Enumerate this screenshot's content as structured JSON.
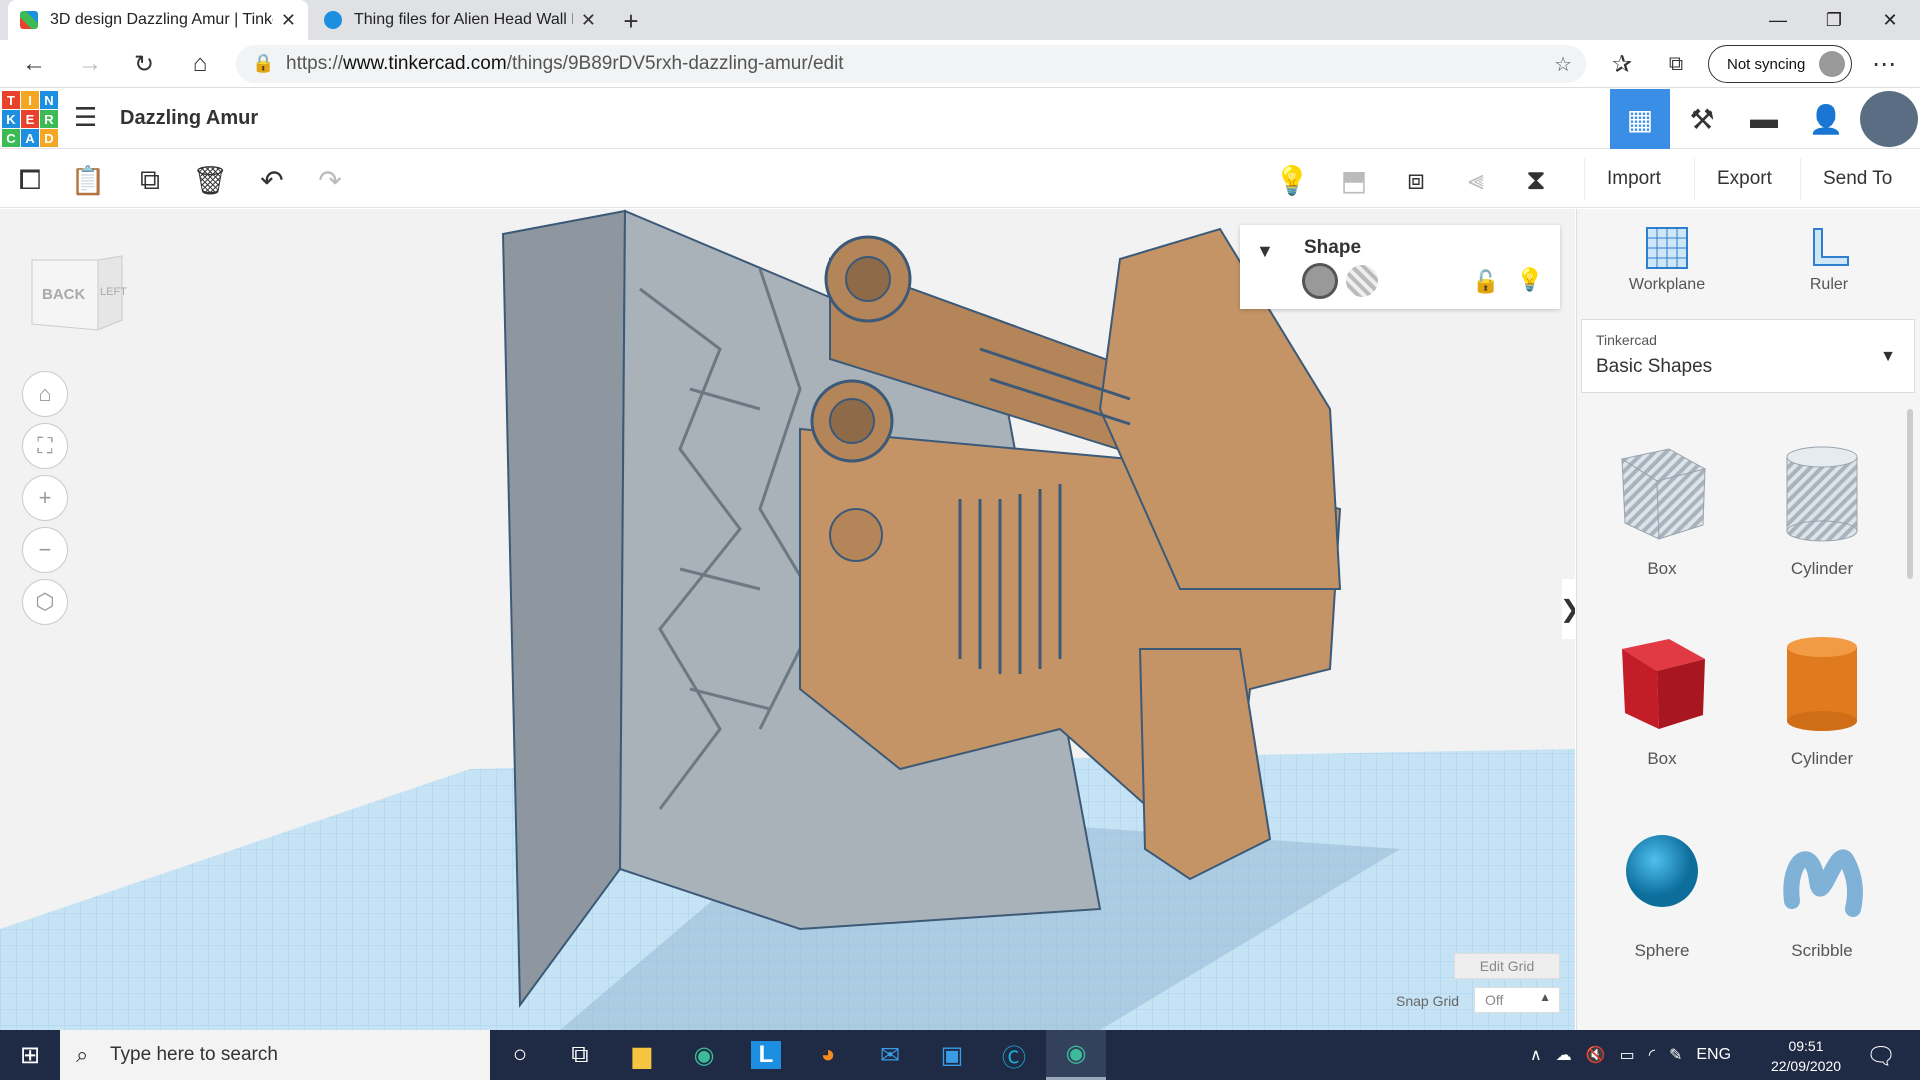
{
  "browser": {
    "tabs": [
      {
        "title": "3D design Dazzling Amur | Tinke",
        "active": true
      },
      {
        "title": "Thing files for Alien Head Wall H",
        "active": false
      }
    ],
    "url_prefix": "https://",
    "url_domain": "www.tinkercad.com",
    "url_path": "/things/9B89rDV5rxh-dazzling-amur/edit",
    "sync_label": "Not syncing"
  },
  "app": {
    "logo_letters": [
      "T",
      "I",
      "N",
      "K",
      "E",
      "R",
      "C",
      "A",
      "D"
    ],
    "logo_colors": [
      "#e8412c",
      "#f5a623",
      "#1d8fe1",
      "#1d8fe1",
      "#e8412c",
      "#3cba54",
      "#3cba54",
      "#1d8fe1",
      "#f5a623"
    ],
    "design_name": "Dazzling Amur",
    "accent": "#3a8ee6"
  },
  "toolbar": {
    "import_label": "Import",
    "export_label": "Export",
    "send_to_label": "Send To"
  },
  "viewcube": {
    "back": "BACK",
    "left": "LEFT"
  },
  "shape_panel": {
    "title": "Shape"
  },
  "grid": {
    "edit_label": "Edit Grid",
    "snap_label": "Snap Grid",
    "snap_value": "Off"
  },
  "right_panel": {
    "workplane_label": "Workplane",
    "ruler_label": "Ruler",
    "library_source": "Tinkercad",
    "library_name": "Basic Shapes",
    "shapes": [
      {
        "label": "Box",
        "style": "hole"
      },
      {
        "label": "Cylinder",
        "style": "hole"
      },
      {
        "label": "Box",
        "color": "#d21f2a"
      },
      {
        "label": "Cylinder",
        "color": "#e8761c"
      },
      {
        "label": "Sphere",
        "color": "#1a8fc7"
      },
      {
        "label": "Scribble",
        "color": "#7fb2d6"
      }
    ]
  },
  "taskbar": {
    "search_placeholder": "Type here to search",
    "lang": "ENG",
    "time": "09:51",
    "date": "22/09/2020"
  }
}
